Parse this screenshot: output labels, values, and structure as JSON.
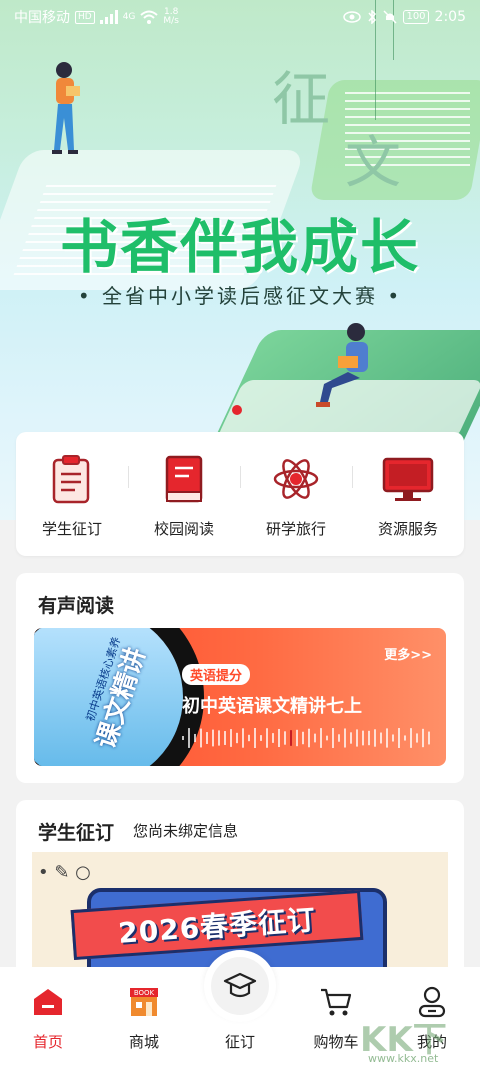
{
  "status_bar": {
    "carrier": "中国移动",
    "hd_badge": "HD",
    "signal_badge": "4G",
    "speed_value": "1.8",
    "speed_unit": "M/s",
    "battery": "100",
    "time": "2:05"
  },
  "hero": {
    "char_top": "征",
    "char_bottom": "文",
    "title": "书香伴我成长",
    "subtitle": "• 全省中小学读后感征文大赛 •"
  },
  "quick_access": [
    {
      "label": "学生征订",
      "icon": "clipboard-icon"
    },
    {
      "label": "校园阅读",
      "icon": "book-icon"
    },
    {
      "label": "研学旅行",
      "icon": "atom-icon"
    },
    {
      "label": "资源服务",
      "icon": "monitor-icon"
    }
  ],
  "audio_reading": {
    "section_title": "有声阅读",
    "more_label": "更多>>",
    "tag": "英语提分",
    "book_title": "初中英语课文精讲七上",
    "cover_title": "课文精讲",
    "cover_subtitle": "初中英语核心素养"
  },
  "student_sub": {
    "section_title": "学生征订",
    "hint": "您尚未绑定信息",
    "promo_text": "2026春季征订"
  },
  "tabbar": {
    "items": [
      {
        "label": "首页",
        "icon": "home-icon",
        "active": true
      },
      {
        "label": "商城",
        "icon": "store-icon",
        "active": false
      },
      {
        "label": "征订",
        "icon": "graduation-cap-icon",
        "active": false
      },
      {
        "label": "购物车",
        "icon": "cart-icon",
        "active": false
      },
      {
        "label": "我的",
        "icon": "user-icon",
        "active": false
      }
    ]
  },
  "watermark": {
    "text": "KK下载",
    "url": "www.kkx.net"
  },
  "colors": {
    "accent": "#e5262d",
    "hero_title": "#1fbe69",
    "banner": "#ff4a2a"
  }
}
